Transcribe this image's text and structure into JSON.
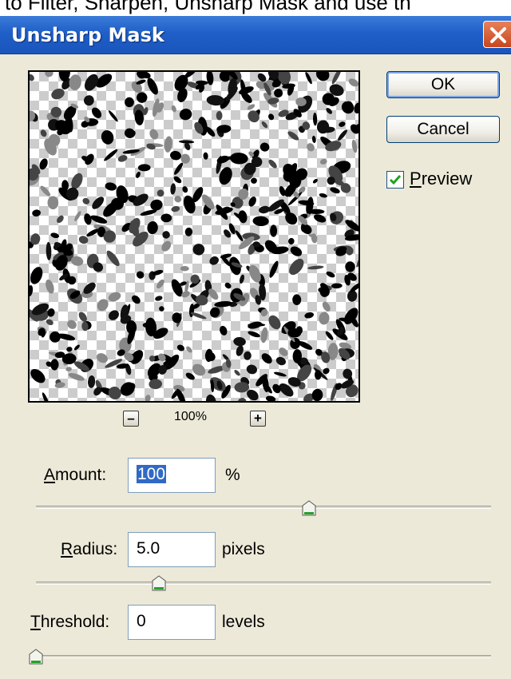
{
  "caption": {
    "text": "to Filter, Sharpen, Unsharp Mask and use th"
  },
  "dialog": {
    "title": "Unsharp Mask"
  },
  "buttons": {
    "ok": "OK",
    "cancel": "Cancel"
  },
  "preview": {
    "label": "Preview",
    "accesskey": "P",
    "label_rest": "review",
    "checked": true
  },
  "zoom": {
    "level": "100%",
    "zoom_out": "–",
    "zoom_in": "+"
  },
  "fields": {
    "amount": {
      "label_key": "A",
      "label_rest": "mount:",
      "value": "100",
      "unit": "%",
      "slider_fraction": 0.6
    },
    "radius": {
      "label_key": "R",
      "label_rest": "adius:",
      "value": "5.0",
      "unit": "pixels",
      "slider_fraction": 0.27
    },
    "threshold": {
      "label_key": "T",
      "label_rest": "hreshold:",
      "value": "0",
      "unit": "levels",
      "slider_fraction": 0.0
    }
  },
  "colors": {
    "titlebar": "#1f5fc8",
    "dialog_bg": "#ece9d8",
    "selection": "#316ac5",
    "close_button": "#d5582c",
    "check_green": "#21a121"
  }
}
